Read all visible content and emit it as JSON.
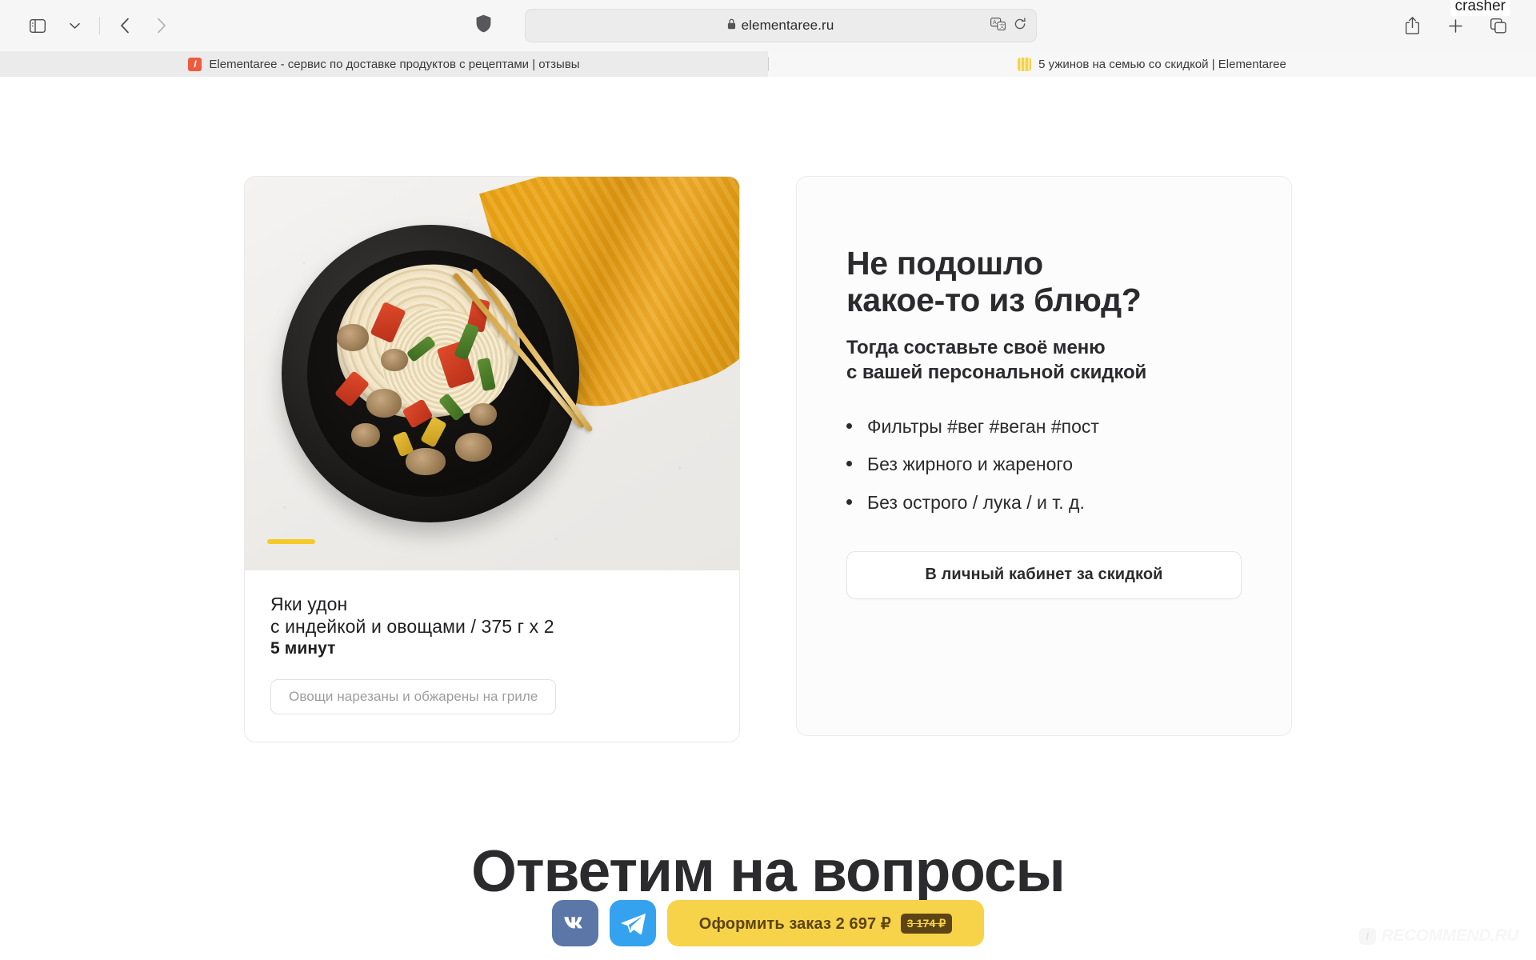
{
  "browser": {
    "url": "elementaree.ru",
    "lock_icon": "lock-icon",
    "sidebar_icon": "sidebar-icon",
    "sidebar_chevron_icon": "chevron-down-icon",
    "back_icon": "chevron-left-icon",
    "forward_icon": "chevron-right-icon",
    "shield_icon": "privacy-shield-icon",
    "translate_icon": "translate-icon",
    "reload_icon": "reload-icon",
    "share_icon": "share-icon",
    "new_tab_icon": "plus-icon",
    "tab_overview_icon": "tab-overview-icon",
    "profile_label": "crasher",
    "tabs": [
      {
        "title": "Elementaree - сервис по доставке продуктов с рецептами | отзывы",
        "favicon": "elementaree-favicon",
        "active": true
      },
      {
        "title": "5 ужинов на семью со скидкой | Elementaree",
        "favicon": "elementaree-stripes-favicon",
        "active": false
      }
    ]
  },
  "dish_card": {
    "photo_alt": "yaki-udon-bowl-photo",
    "title": "Яки удон",
    "subtitle": "с индейкой и овощами / 375 г х 2",
    "cook_time": "5 минут",
    "tag": "Овощи нарезаны и обжарены на гриле",
    "accent_color": "#f5c927"
  },
  "promo": {
    "heading_line1": "Не подошло",
    "heading_line2": "какое-то из блюд?",
    "subheading_line1": "Тогда составьте своё меню",
    "subheading_line2": "с вашей персональной скидкой",
    "bullets": [
      "Фильтры #вег #веган #пост",
      "Без жирного и жареного",
      "Без острого / лука / и т. д."
    ],
    "cta_label": "В личный кабинет за скидкой"
  },
  "section": {
    "faq_heading": "Ответим на вопросы"
  },
  "footer": {
    "vk_label": "VK",
    "vk_icon": "vk-icon",
    "vk_color": "#5a77a8",
    "telegram_icon": "telegram-icon",
    "telegram_color": "#35a2f0",
    "order_label": "Оформить заказ 2 697 ₽",
    "order_old_price": "3 174 ₽",
    "order_color": "#f6d348"
  },
  "watermark": {
    "badge": "I",
    "text": "RECOMMEND.RU"
  }
}
